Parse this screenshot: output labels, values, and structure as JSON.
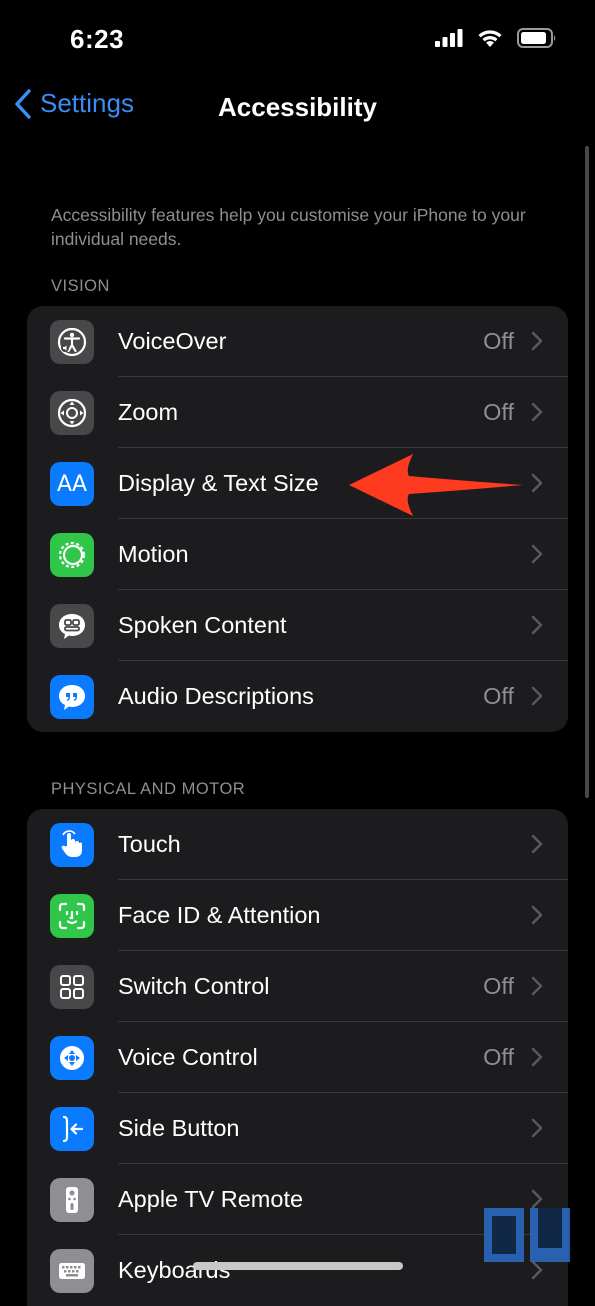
{
  "status_bar": {
    "time": "6:23"
  },
  "nav": {
    "back_label": "Settings",
    "title": "Accessibility"
  },
  "description": "Accessibility features help you customise your iPhone to your individual needs.",
  "sections": {
    "vision": {
      "header": "VISION",
      "items": [
        {
          "label": "VoiceOver",
          "value": "Off",
          "icon": "voiceover-icon",
          "color": "#48484a"
        },
        {
          "label": "Zoom",
          "value": "Off",
          "icon": "zoom-icon",
          "color": "#48484a"
        },
        {
          "label": "Display & Text Size",
          "value": "",
          "icon": "text-size-icon",
          "color": "#0a7aff"
        },
        {
          "label": "Motion",
          "value": "",
          "icon": "motion-icon",
          "color": "#30c64a"
        },
        {
          "label": "Spoken Content",
          "value": "",
          "icon": "spoken-content-icon",
          "color": "#48484a"
        },
        {
          "label": "Audio Descriptions",
          "value": "Off",
          "icon": "audio-descriptions-icon",
          "color": "#0a7aff"
        }
      ]
    },
    "motor": {
      "header": "PHYSICAL AND MOTOR",
      "items": [
        {
          "label": "Touch",
          "value": "",
          "icon": "touch-hand-icon",
          "color": "#0a7aff"
        },
        {
          "label": "Face ID & Attention",
          "value": "",
          "icon": "face-id-icon",
          "color": "#30c64a"
        },
        {
          "label": "Switch Control",
          "value": "Off",
          "icon": "switch-control-icon",
          "color": "#48484a"
        },
        {
          "label": "Voice Control",
          "value": "Off",
          "icon": "voice-control-icon",
          "color": "#0a7aff"
        },
        {
          "label": "Side Button",
          "value": "",
          "icon": "side-button-icon",
          "color": "#0a7aff"
        },
        {
          "label": "Apple TV Remote",
          "value": "",
          "icon": "tv-remote-icon",
          "color": "#8e8e93"
        },
        {
          "label": "Keyboards",
          "value": "",
          "icon": "keyboard-icon",
          "color": "#8e8e93"
        }
      ]
    }
  },
  "annotation": {
    "arrow_color": "#ff3b1f"
  },
  "colors": {
    "accent": "#3a8df5",
    "background": "#000000",
    "cell": "#1c1c1e"
  }
}
